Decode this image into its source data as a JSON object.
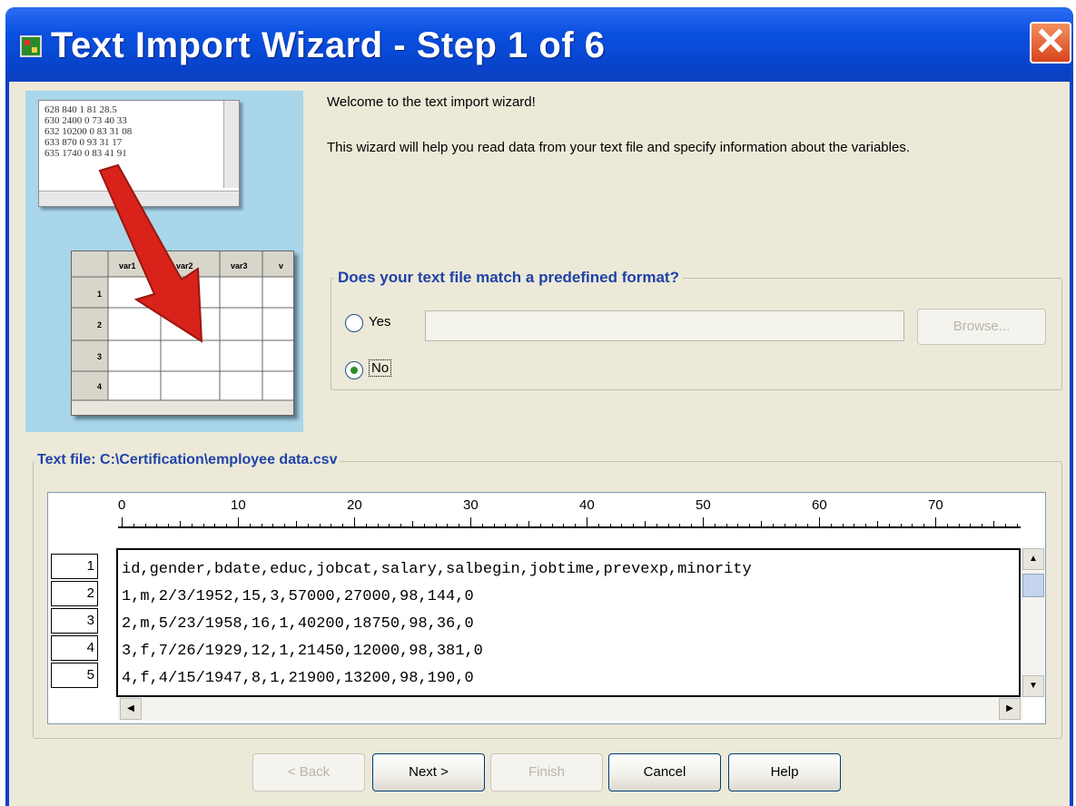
{
  "window": {
    "title": "Text Import Wizard - Step 1 of 6",
    "close_label": "✕"
  },
  "illustration": {
    "note_lines": [
      "628 840 1 81 28.5",
      "630 2400 0 73 40 33",
      "632 10200 0 83 31 08",
      "633 870 0 93 31 17",
      "635 1740 0 83 41 91"
    ],
    "columns": [
      "var1",
      "var2",
      "var3",
      "v"
    ],
    "rows": [
      "1",
      "2",
      "3",
      "4"
    ]
  },
  "intro": {
    "welcome": "Welcome to the text import wizard!",
    "description": "This wizard will help you read data from your text file and specify information about the variables."
  },
  "format_group": {
    "legend": "Does your text file match a predefined format?",
    "yes_label": "Yes",
    "no_label": "No",
    "selected": "No",
    "path_value": "",
    "browse_label": "Browse..."
  },
  "text_file": {
    "legend": "Text file:  C:\\Certification\\employee data.csv",
    "ruler_labels": [
      "0",
      "10",
      "20",
      "30",
      "40",
      "50",
      "60",
      "70"
    ],
    "row_numbers": [
      "1",
      "2",
      "3",
      "4",
      "5"
    ],
    "lines": [
      "id,gender,bdate,educ,jobcat,salary,salbegin,jobtime,prevexp,minority",
      "1,m,2/3/1952,15,3,57000,27000,98,144,0",
      "2,m,5/23/1958,16,1,40200,18750,98,36,0",
      "3,f,7/26/1929,12,1,21450,12000,98,381,0",
      "4,f,4/15/1947,8,1,21900,13200,98,190,0"
    ]
  },
  "buttons": {
    "back": "< Back",
    "next": "Next >",
    "finish": "Finish",
    "cancel": "Cancel",
    "help": "Help"
  },
  "colors": {
    "title_bar": "#0a50e0",
    "dialog_bg": "#ece9d8",
    "group_title": "#1f43a8",
    "illustration_bg": "#a9d6ea",
    "arrow": "#d8221a"
  }
}
